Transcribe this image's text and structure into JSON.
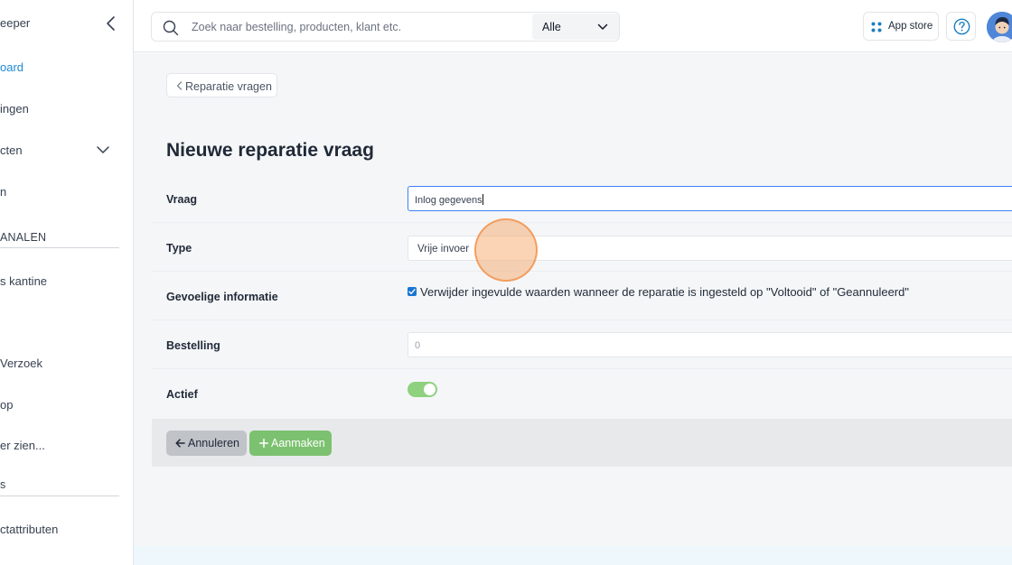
{
  "sidebar": {
    "brand": "eeper",
    "items": [
      {
        "label": "oard",
        "active": true
      },
      {
        "label": "ingen"
      },
      {
        "label": "cten"
      },
      {
        "label": "n"
      },
      {
        "label": "s kantine"
      },
      {
        "label": "Verzoek"
      },
      {
        "label": "op"
      },
      {
        "label": "er zien..."
      },
      {
        "label": "ctattributen"
      }
    ],
    "sections": [
      "ANALEN",
      "s"
    ]
  },
  "header": {
    "search_placeholder": "Zoek naar bestelling, producten, klant etc.",
    "search_scope": "Alle",
    "appstore_label": "App store"
  },
  "main": {
    "back_label": "Reparatie vragen",
    "title": "Nieuwe reparatie vraag",
    "form": {
      "vraag_label": "Vraag",
      "vraag_value": "Inlog gegevens",
      "type_label": "Type",
      "type_value": "Vrije invoer",
      "gevoelig_label": "Gevoelige informatie",
      "gevoelig_checkbox_label": "Verwijder ingevulde waarden wanneer de reparatie is ingesteld op \"Voltooid\" of \"Geannuleerd\"",
      "gevoelig_checked": true,
      "bestelling_label": "Bestelling",
      "bestelling_value": "0",
      "actief_label": "Actief",
      "actief_on": true
    },
    "cancel_label": "Annuleren",
    "create_label": "Aanmaken"
  },
  "colors": {
    "accent": "#1d8ad6",
    "toggle_on": "#8ed17f",
    "create_button": "#7cc170",
    "cancel_button": "#c0c3c7",
    "checkbox": "#1976d2"
  },
  "icons": [
    "chevron-left-icon",
    "chevron-down-icon",
    "search-icon",
    "grid-dots-icon",
    "help-icon",
    "arrow-left-icon",
    "plus-icon",
    "check-icon"
  ]
}
